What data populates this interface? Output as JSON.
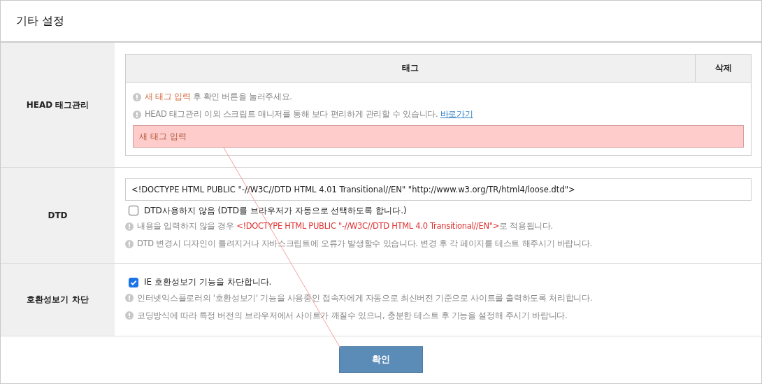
{
  "title": "기타 설정",
  "sections": [
    {
      "kind": "tags",
      "label": "HEAD 태그관리",
      "columns": [
        "태그",
        "삭제"
      ],
      "notes": [
        [
          {
            "text": "새 태그 입력",
            "kind": "highlight"
          },
          {
            "text": " 후 확인 버튼을 눌러주세요.",
            "kind": "plain"
          }
        ],
        [
          {
            "text": "HEAD 태그관리 이외 스크립트 매니저를 통해 보다 편리하게 관리할 수 있습니다. ",
            "kind": "plain"
          },
          {
            "text": "바로가기",
            "kind": "link"
          }
        ]
      ],
      "input": {
        "placeholder": "새 태그 입력",
        "invalid": true
      }
    },
    {
      "kind": "dtd",
      "label": "DTD",
      "value": "<!DOCTYPE HTML PUBLIC \"-//W3C//DTD HTML 4.01 Transitional//EN\" \"http://www.w3.org/TR/html4/loose.dtd\">",
      "checkbox": {
        "label": "DTD사용하지 않음 (DTD를 브라우저가 자동으로 선택하도록 합니다.)",
        "checked": false
      },
      "notes": [
        [
          {
            "text": "내용을 입력하지 않을 경우 ",
            "kind": "plain"
          },
          {
            "text": "<!DOCTYPE HTML PUBLIC \"-//W3C//DTD HTML 4.0 Transitional//EN\">",
            "kind": "error"
          },
          {
            "text": "로 적용됩니다.",
            "kind": "plain"
          }
        ],
        [
          {
            "text": "DTD 변경시 디자인이 틀려지거나 자바스크립트에 오류가 발생할수 있습니다. 변경 후 각 페이지를 테스트 해주시기 바랍니다.",
            "kind": "plain"
          }
        ]
      ]
    },
    {
      "kind": "compat",
      "label": "호환성보기 차단",
      "checkbox": {
        "label": "IE 호환성보기 기능을 차단합니다.",
        "checked": true
      },
      "notes": [
        [
          {
            "text": "인터넷익스플로러의 '호환성보기' 기능을 사용중인 접속자에게 자동으로 최신버전 기준으로 사이트를 출력하도록 처리합니다.",
            "kind": "plain"
          }
        ],
        [
          {
            "text": "코딩방식에 따라 특정 버전의 브라우저에서 사이트가 깨질수 있으니, 충분한 테스트 후 기능을 설정해 주시기 바랍니다.",
            "kind": "plain"
          }
        ]
      ]
    }
  ],
  "confirm_button": "확인"
}
